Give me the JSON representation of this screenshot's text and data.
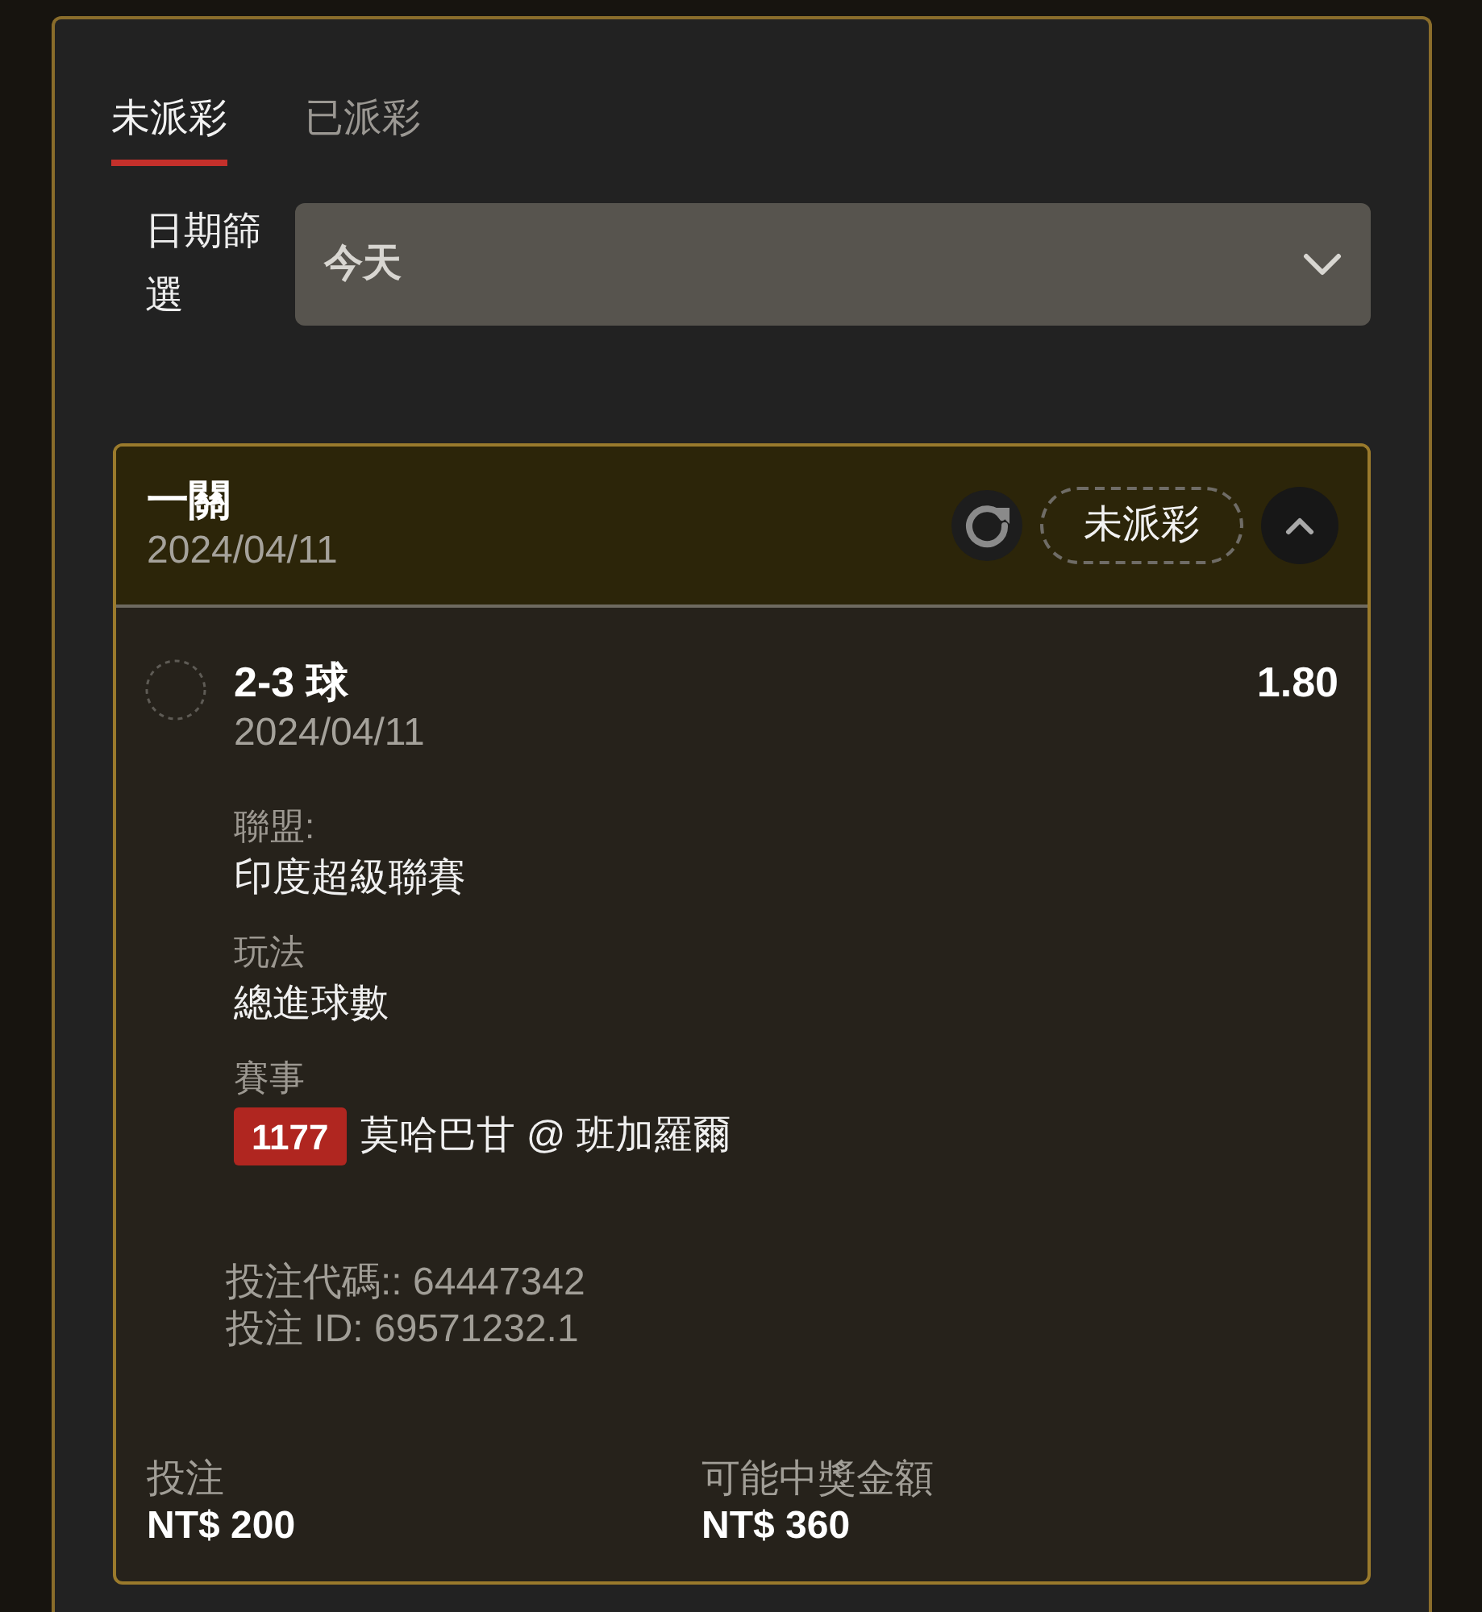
{
  "tabs": [
    {
      "label": "未派彩",
      "selected": true
    },
    {
      "label": "已派彩",
      "selected": false
    }
  ],
  "date_filter": {
    "label": "日期篩選",
    "value": "今天"
  },
  "bet": {
    "title": "一關",
    "date": "2024/04/11",
    "status": "未派彩",
    "expanded": true,
    "selection": {
      "name": "2-3 球",
      "odds": "1.80",
      "date": "2024/04/11",
      "details": [
        {
          "label": "聯盟:",
          "value": "印度超級聯賽"
        },
        {
          "label": "玩法",
          "value": "總進球數"
        },
        {
          "label": "賽事",
          "badge": "1177",
          "value": "莫哈巴甘 @ 班加羅爾"
        }
      ]
    },
    "bet_code": "投注代碼:: 64447342",
    "bet_id": "投注 ID: 69571232.1",
    "stake": {
      "label": "投注",
      "value": "NT$ 200"
    },
    "payout": {
      "label": "可能中獎金額",
      "value": "NT$ 360"
    }
  }
}
